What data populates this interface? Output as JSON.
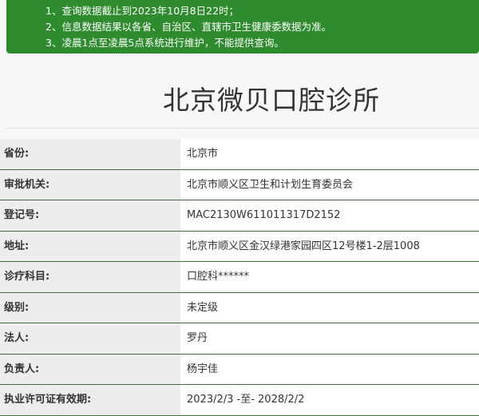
{
  "notice": {
    "lines": [
      "1、查询数据截止到2023年10月8日22时；",
      "2、信息数据结果以各省、自治区、直辖市卫生健康委数据为准。",
      "3、凌晨1点至凌晨5点系统进行维护，不能提供查询。"
    ],
    "background_color": "#2e8b2e"
  },
  "title": "北京微贝口腔诊所",
  "details": [
    {
      "label": "省份:",
      "value": "北京市"
    },
    {
      "label": "审批机关:",
      "value": "北京市顺义区卫生和计划生育委员会"
    },
    {
      "label": "登记号:",
      "value": "MAC2130W611011317D2152"
    },
    {
      "label": "地址:",
      "value": "北京市顺义区金汉绿港家园四区12号楼1-2层1008"
    },
    {
      "label": "诊疗科目:",
      "value": "口腔科******"
    },
    {
      "label": "级别:",
      "value": "未定级"
    },
    {
      "label": "法人:",
      "value": "罗丹"
    },
    {
      "label": "负责人:",
      "value": "杨宇佳"
    },
    {
      "label": "执业许可证有效期:",
      "value": "2023/2/3 -至- 2028/2/2"
    }
  ]
}
